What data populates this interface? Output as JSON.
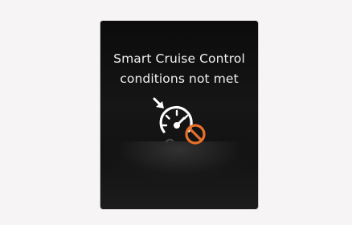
{
  "display": {
    "message_line1": "Smart Cruise Control",
    "message_line2": "conditions not met",
    "icons": {
      "speedometer": "speedometer-icon",
      "arrow": "arrow-pointer-icon",
      "prohibited": "prohibited-icon"
    },
    "colors": {
      "background": "#f6f4f4",
      "screen": "#0b0b0b",
      "text": "#f2f2f2",
      "warning": "#e8702a"
    }
  }
}
